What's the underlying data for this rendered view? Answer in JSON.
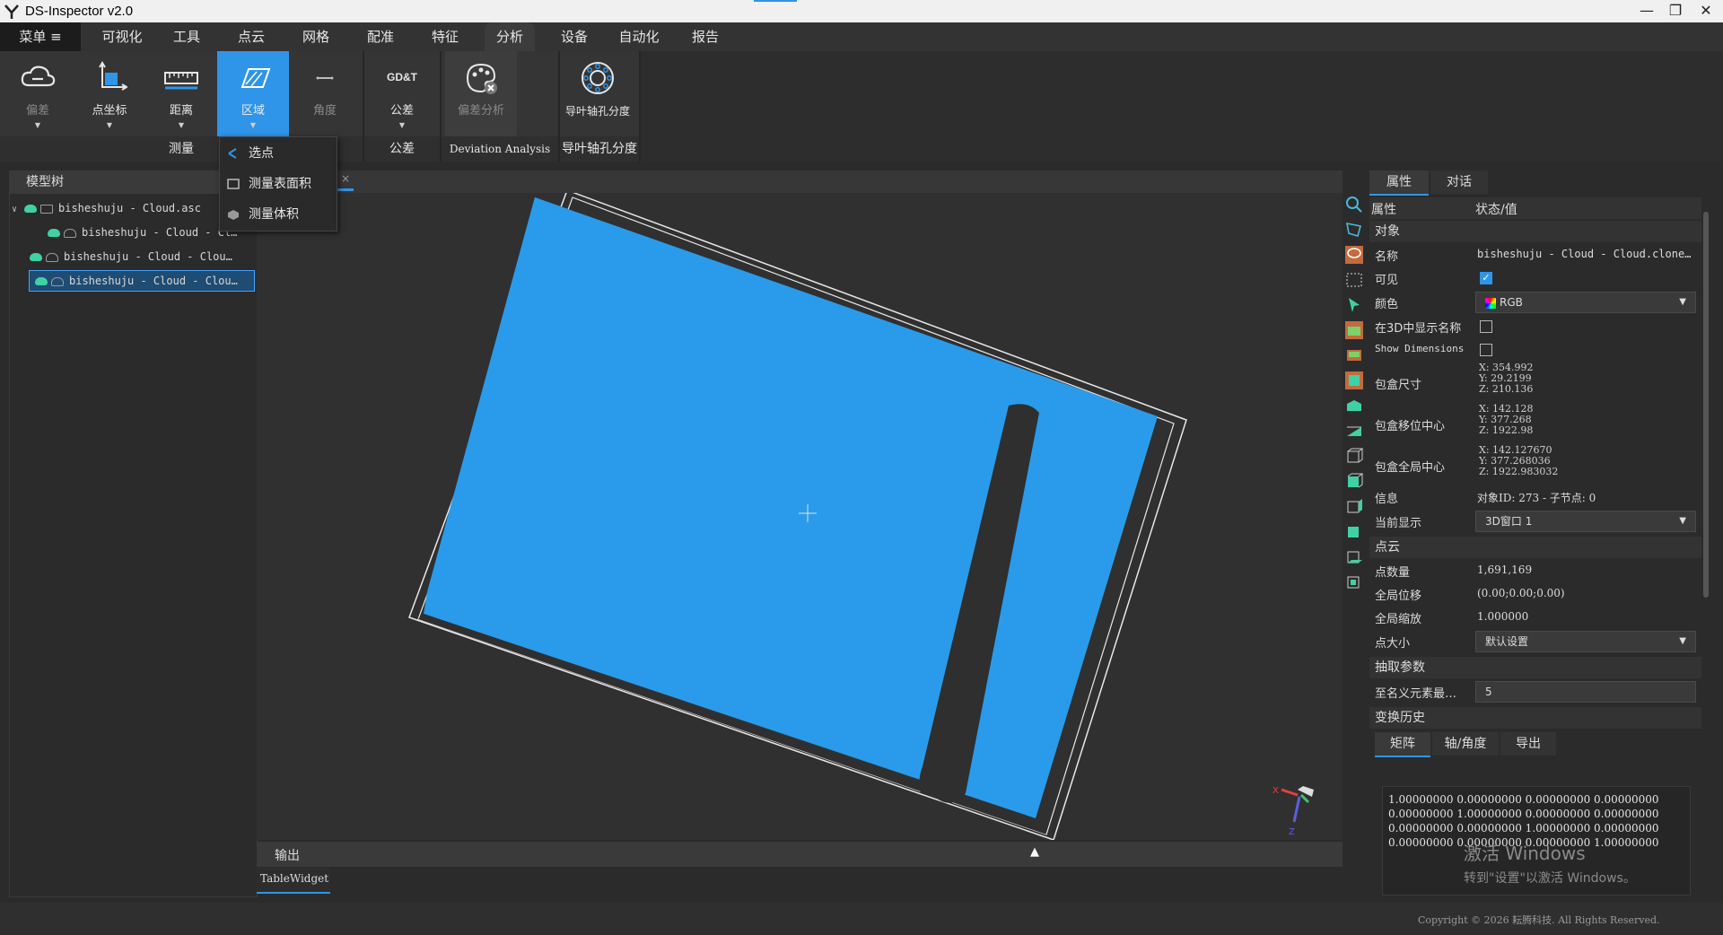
{
  "window": {
    "title": "DS-Inspector v2.0",
    "min": "—",
    "max": "❐",
    "close": "✕"
  },
  "menu": {
    "main": "菜单 ≡",
    "items": [
      "可视化",
      "工具",
      "点云",
      "网格",
      "配准",
      "特征",
      "分析",
      "设备",
      "自动化",
      "报告"
    ],
    "active": "分析"
  },
  "ribbon": {
    "buttons": [
      {
        "label": "偏差",
        "enabled": false
      },
      {
        "label": "点坐标",
        "enabled": true
      },
      {
        "label": "距离",
        "enabled": true
      },
      {
        "label": "区域",
        "enabled": true,
        "active": true
      },
      {
        "label": "角度",
        "enabled": false
      },
      {
        "label": "公差",
        "enabled": true,
        "icon_text": "GD&T"
      },
      {
        "label": "偏差分析",
        "enabled": false
      },
      {
        "label": "导叶轴孔分度",
        "enabled": true
      }
    ],
    "groups": [
      "测量",
      "公差",
      "Deviation Analysis",
      "导叶轴孔分度"
    ]
  },
  "area_dropdown": [
    "选点",
    "测量表面积",
    "测量体积"
  ],
  "model_tree": {
    "title": "模型树",
    "items": [
      "bisheshuju - Cloud.asc",
      "bisheshuju - Cloud - Cl…",
      "bisheshuju - Cloud - Clou…",
      "bisheshuju - Cloud - Clou…"
    ]
  },
  "viewport": {
    "tab_close": "×",
    "axis_x": "X",
    "axis_z": "Z"
  },
  "output": {
    "title": "输出",
    "tab": "TableWidget"
  },
  "props": {
    "tabs": [
      "属性",
      "对话"
    ],
    "header_key": "属性",
    "header_val": "状态/值",
    "sec_object": "对象",
    "name_k": "名称",
    "name_v": "bisheshuju - Cloud - Cloud.clone…",
    "visible_k": "可见",
    "color_k": "颜色",
    "color_v": "RGB",
    "show3d_k": "在3D中显示名称",
    "showdim_k": "Show Dimensions",
    "bbox_k": "包盒尺寸",
    "bbox_x": "X: 354.992",
    "bbox_y": "Y: 29.2199",
    "bbox_z": "Z: 210.136",
    "bshift_k": "包盒移位中心",
    "bshift_x": "X: 142.128",
    "bshift_y": "Y: 377.268",
    "bshift_z": "Z: 1922.98",
    "bglob_k": "包盒全局中心",
    "bglob_x": "X: 142.127670",
    "bglob_y": "Y: 377.268036",
    "bglob_z": "Z: 1922.983032",
    "info_k": "信息",
    "info_v": "对象ID: 273 - 子节点: 0",
    "disp_k": "当前显示",
    "disp_v": "3D窗口 1",
    "sec_cloud": "点云",
    "npts_k": "点数量",
    "npts_v": "1,691,169",
    "gshift_k": "全局位移",
    "gshift_v": "(0.00;0.00;0.00)",
    "gscale_k": "全局缩放",
    "gscale_v": "1.000000",
    "psize_k": "点大小",
    "psize_v": "默认设置",
    "sec_sub": "抽取参数",
    "sub_k": "至名义元素最…",
    "sub_v": "5",
    "sec_hist": "变换历史",
    "hist_tabs": [
      "矩阵",
      "轴/角度",
      "导出"
    ],
    "matrix": [
      "1.00000000 0.00000000 0.00000000 0.00000000",
      "0.00000000 1.00000000 0.00000000 0.00000000",
      "0.00000000 0.00000000 1.00000000 0.00000000",
      "0.00000000 0.00000000 0.00000000 1.00000000"
    ],
    "activate_title": "激活 Windows",
    "activate_sub": "转到\"设置\"以激活 Windows。"
  },
  "status": {
    "copyright": "Copyright © 2026 耘腾科技. All Rights Reserved."
  },
  "colors": {
    "accent": "#2f95e8",
    "cloud": "#2a9bea",
    "bg": "#2b2b2b"
  }
}
